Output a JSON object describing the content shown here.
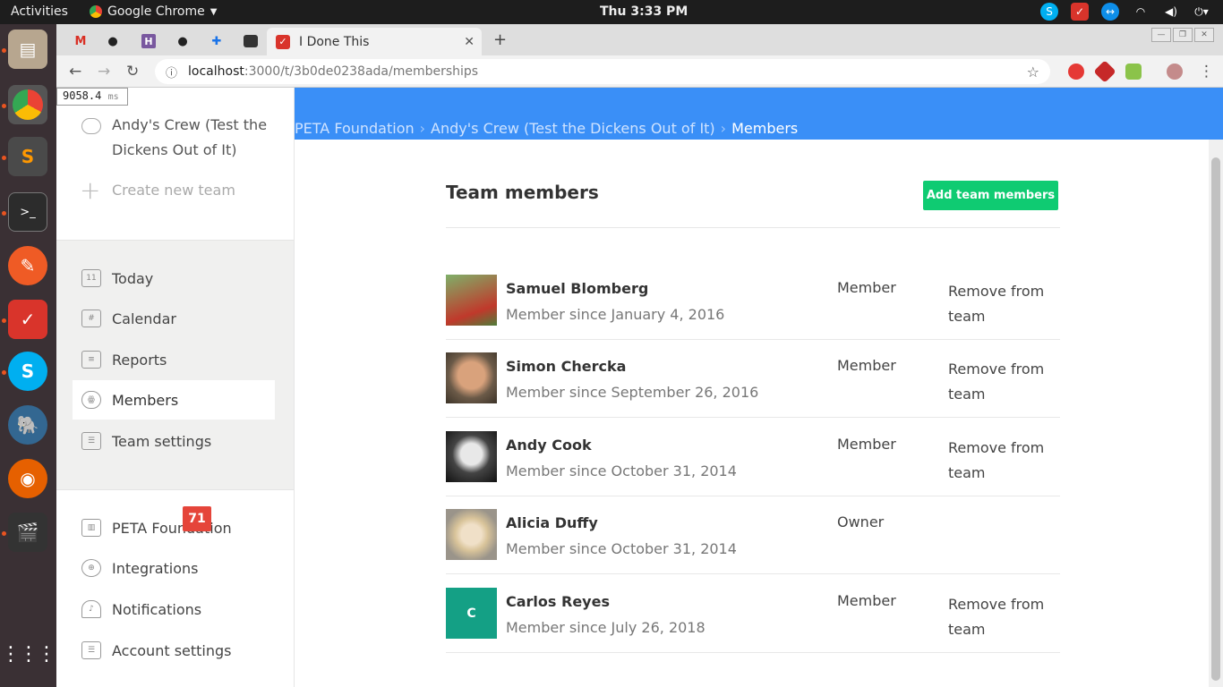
{
  "os": {
    "activities": "Activities",
    "app_menu": "Google Chrome",
    "clock": "Thu  3:33 PM"
  },
  "browser": {
    "active_tab_title": "I Done This",
    "url_host": "localhost",
    "url_path": ":3000/t/3b0de0238ada/memberships",
    "perf_value": "9058.4",
    "perf_unit": "ms"
  },
  "sidebar": {
    "team_name": "Andy's Crew (Test the Dickens Out of It)",
    "create_team": "Create new team",
    "nav": [
      {
        "label": "Today",
        "icon": "calendar-day-icon",
        "icon_text": "11"
      },
      {
        "label": "Calendar",
        "icon": "calendar-grid-icon",
        "icon_text": ""
      },
      {
        "label": "Reports",
        "icon": "reports-icon",
        "icon_text": ""
      },
      {
        "label": "Members",
        "icon": "members-icon",
        "icon_text": ""
      },
      {
        "label": "Team settings",
        "icon": "settings-icon",
        "icon_text": ""
      }
    ],
    "account": [
      {
        "label": "PETA Foundation",
        "icon": "building-icon"
      },
      {
        "label": "Integrations",
        "icon": "globe-icon"
      },
      {
        "label": "Notifications",
        "icon": "bell-icon"
      },
      {
        "label": "Account settings",
        "icon": "settings-icon"
      }
    ],
    "notifications_count": "71"
  },
  "breadcrumb": {
    "org": "PETA Foundation",
    "team": "Andy's Crew (Test the Dickens Out of It)",
    "current": "Members"
  },
  "main": {
    "title": "Team members",
    "add_button": "Add team members",
    "members": [
      {
        "name": "Samuel Blomberg",
        "since": "Member since January 4, 2016",
        "role": "Member",
        "remove": "Remove from team",
        "avatar_color": "#6aa84f",
        "avatar_initial": ""
      },
      {
        "name": "Simon Chercka",
        "since": "Member since September 26, 2016",
        "role": "Member",
        "remove": "Remove from team",
        "avatar_color": "#8a7560",
        "avatar_initial": ""
      },
      {
        "name": "Andy Cook",
        "since": "Member since October 31, 2014",
        "role": "Member",
        "remove": "Remove from team",
        "avatar_color": "#222222",
        "avatar_initial": ""
      },
      {
        "name": "Alicia Duffy",
        "since": "Member since October 31, 2014",
        "role": "Owner",
        "remove": "",
        "avatar_color": "#b9b2a6",
        "avatar_initial": ""
      },
      {
        "name": "Carlos Reyes",
        "since": "Member since July 26, 2018",
        "role": "Member",
        "remove": "Remove from team",
        "avatar_color": "#14a085",
        "avatar_initial": "C"
      }
    ]
  },
  "colors": {
    "banner": "#3a8ff7",
    "add_button": "#0fcb72",
    "badge": "#e5453a"
  }
}
